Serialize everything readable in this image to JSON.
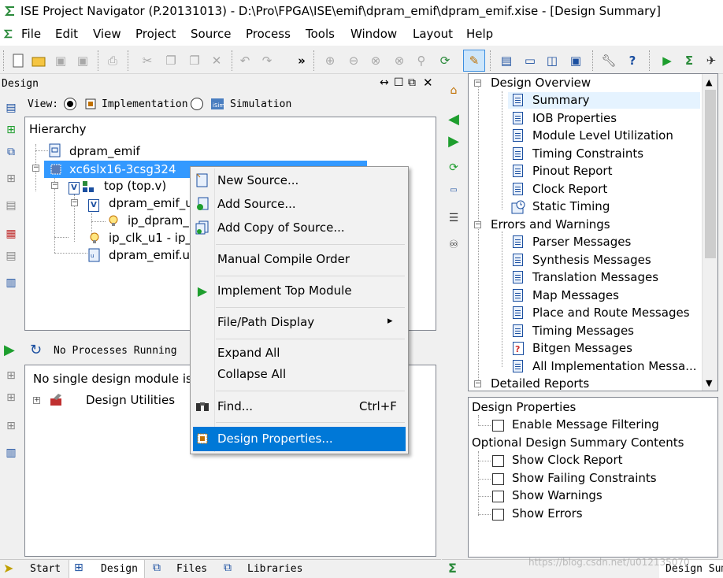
{
  "window": {
    "title": "ISE Project Navigator (P.20131013) - D:\\Pro\\FPGA\\ISE\\emif\\dpram_emif\\dpram_emif.xise - [Design Summary]"
  },
  "menubar": [
    "File",
    "Edit",
    "View",
    "Project",
    "Source",
    "Process",
    "Tools",
    "Window",
    "Layout",
    "Help"
  ],
  "toolbar": {
    "overflow": "»"
  },
  "design_panel": {
    "title": "Design",
    "view_label": "View:",
    "view_options": [
      {
        "label": "Implementation",
        "selected": true
      },
      {
        "label": "Simulation",
        "selected": false
      }
    ],
    "hierarchy_label": "Hierarchy",
    "tree": [
      "dpram_emif",
      "xc6slx16-3csg324",
      "top (top.v)",
      "dpram_emif_u",
      "ip_dpram_",
      "ip_clk_u1 - ip_",
      "dpram_emif.uc"
    ]
  },
  "processes_panel": {
    "status": "No Processes Running",
    "message": "No single design module is",
    "item": "Design Utilities"
  },
  "context_menu": {
    "items": [
      {
        "label": "New Source..."
      },
      {
        "label": "Add Source..."
      },
      {
        "label": "Add Copy of Source..."
      },
      {
        "label": "Manual Compile Order"
      },
      {
        "label": "Implement Top Module"
      },
      {
        "label": "File/Path Display",
        "submenu_arrow": "▸"
      },
      {
        "label": "Expand All"
      },
      {
        "label": "Collapse All"
      },
      {
        "label": "Find...",
        "shortcut": "Ctrl+F"
      },
      {
        "label": "Design Properties...",
        "highlighted": true
      }
    ]
  },
  "summary_tree": {
    "design_overview": "Design Overview",
    "overview_items": [
      "Summary",
      "IOB Properties",
      "Module Level Utilization",
      "Timing Constraints",
      "Pinout Report",
      "Clock Report",
      "Static Timing"
    ],
    "errors_warnings": "Errors and Warnings",
    "ew_items": [
      "Parser Messages",
      "Synthesis Messages",
      "Translation Messages",
      "Map Messages",
      "Place and Route Messages",
      "Timing Messages",
      "Bitgen Messages",
      "All Implementation Messa..."
    ],
    "detailed_reports": "Detailed Reports"
  },
  "design_properties": {
    "title": "Design Properties",
    "enable_filtering": "Enable Message Filtering",
    "optional_title": "Optional Design Summary Contents",
    "options": [
      "Show Clock Report",
      "Show Failing Constraints",
      "Show Warnings",
      "Show Errors"
    ]
  },
  "bottom_tabs": [
    "Start",
    "Design",
    "Files",
    "Libraries"
  ],
  "right_bottom_tab": "Design Sum",
  "watermark": "https://blog.csdn.net/u012135070",
  "colors": {
    "highlight": "#0078d7",
    "selection_row": "#3399ff",
    "summary_row": "#e5f3ff"
  }
}
